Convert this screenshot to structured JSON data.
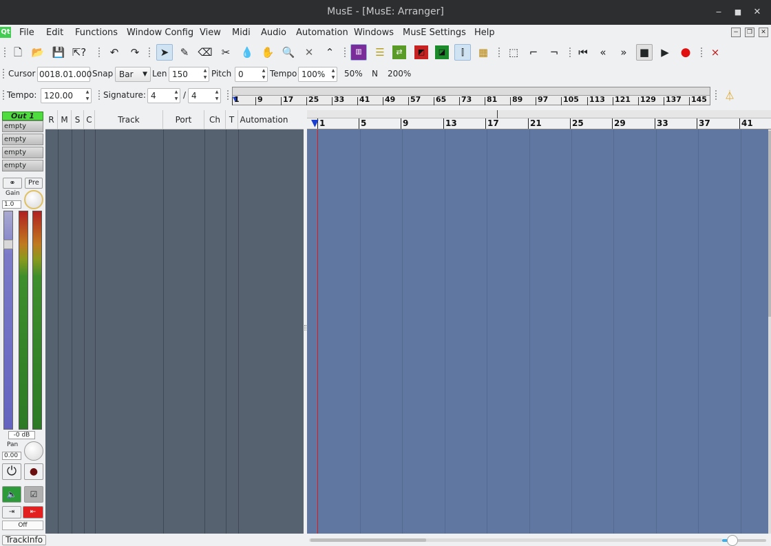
{
  "window": {
    "title": "MusE - [MusE: Arranger]"
  },
  "menubar": {
    "logo": "Qt",
    "items": [
      "File",
      "Edit",
      "Functions",
      "Window Config",
      "View",
      "Midi",
      "Audio",
      "Automation",
      "Windows",
      "MusE Settings",
      "Help"
    ]
  },
  "toolbar2": {
    "cursor_label": "Cursor",
    "cursor_value": "0018.01.000",
    "snap_label": "Snap",
    "snap_value": "Bar",
    "len_label": "Len",
    "len_value": "150",
    "pitch_label": "Pitch",
    "pitch_value": "0",
    "tempo_label": "Tempo",
    "tempo_value": "100%",
    "preset_50": "50%",
    "preset_n": "N",
    "preset_200": "200%"
  },
  "toolbar3": {
    "tempo_label": "Tempo:",
    "tempo_value": "120.00",
    "signature_label": "Signature:",
    "sig_num": "4",
    "sig_sep": "/",
    "sig_den": "4"
  },
  "master_ruler": {
    "marks": [
      "1",
      "9",
      "17",
      "25",
      "33",
      "41",
      "49",
      "57",
      "65",
      "73",
      "81",
      "89",
      "97",
      "105",
      "113",
      "121",
      "129",
      "137",
      "145"
    ]
  },
  "strip": {
    "name": "Out 1",
    "slots": [
      "empty",
      "empty",
      "empty",
      "empty"
    ],
    "pre_label": "Pre",
    "gain_label": "Gain",
    "gain_value": "1.0",
    "db_value": "-0 dB",
    "pan_label": "Pan",
    "pan_value": "0.00",
    "off_label": "Off"
  },
  "track_header": {
    "cols": [
      "R",
      "M",
      "S",
      "C",
      "Track",
      "Port",
      "Ch",
      "T",
      "Automation"
    ]
  },
  "arranger_ruler": {
    "bars": [
      "1",
      "5",
      "9",
      "13",
      "17",
      "21",
      "25",
      "29",
      "33",
      "37",
      "41"
    ]
  },
  "status": {
    "trackinfo": "TrackInfo"
  },
  "colors": {
    "canvas": "#6077a2",
    "tracklist": "#566270",
    "strip_name": "#4fdc3e"
  }
}
